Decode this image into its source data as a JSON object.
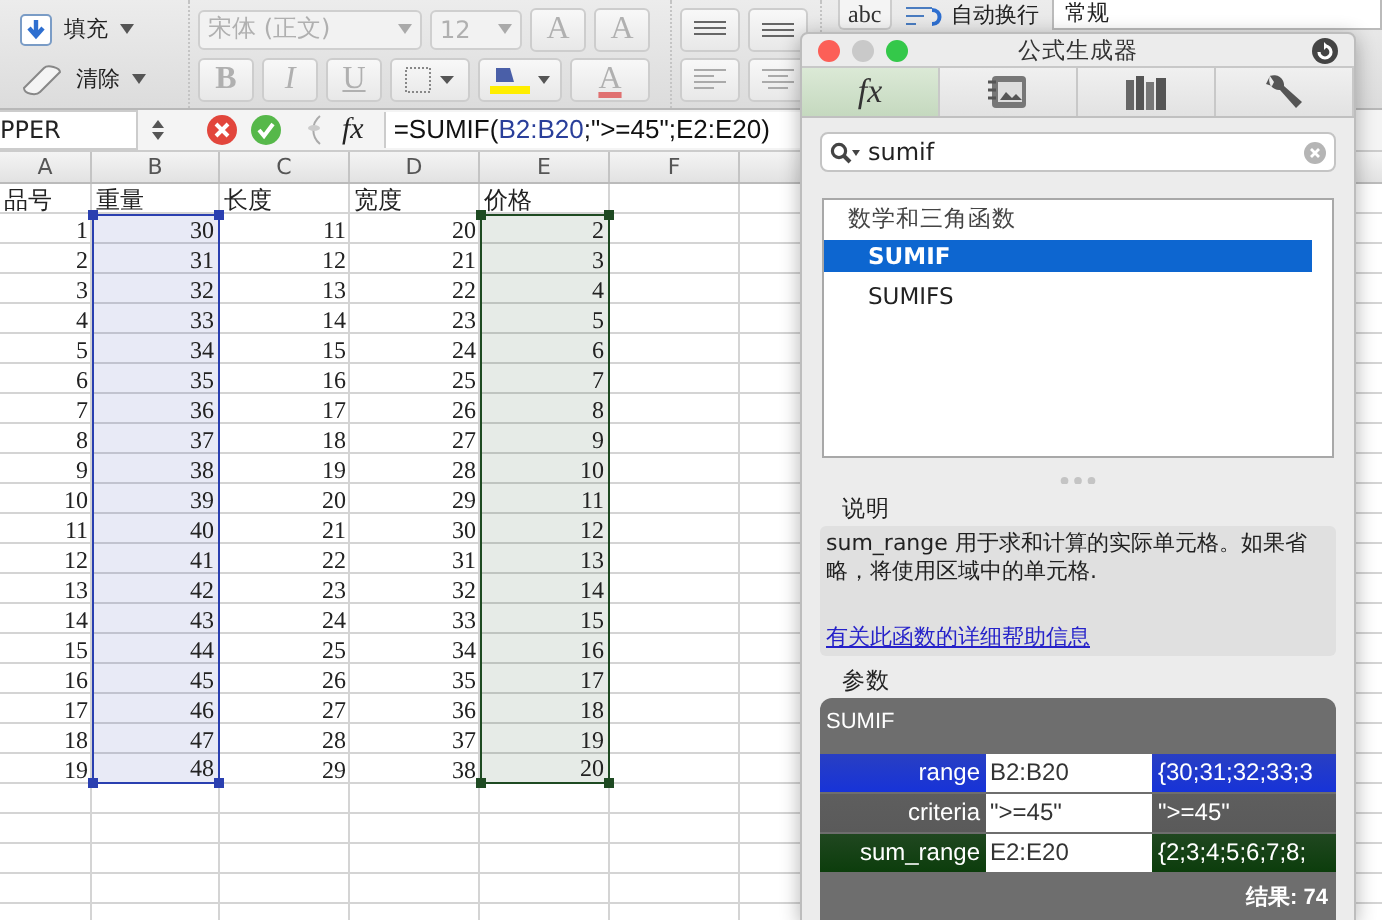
{
  "ribbon": {
    "fill_button": "填充",
    "clear_button": "清除",
    "font_name": "宋体 (正文)",
    "font_size": "12",
    "grow_font": "A",
    "shrink_font": "A",
    "bold": "B",
    "italic": "I",
    "underline": "U",
    "font_color": "A",
    "abc_button": "abc",
    "wrap_button": "自动换行",
    "number_format": "常规"
  },
  "formula_bar": {
    "name_box": "PPER",
    "fx": "fx",
    "formula_parts": [
      {
        "text": "=SUMIF(",
        "color": "#111111"
      },
      {
        "text": "B2:B20",
        "color": "#2a3f9a"
      },
      {
        "text": ";\">=45\";",
        "color": "#111111"
      },
      {
        "text": "E2:E20",
        "color": "#111111"
      },
      {
        "text": ")",
        "color": "#111111"
      }
    ]
  },
  "sheet": {
    "columns": [
      {
        "label": "A"
      },
      {
        "label": "B",
        "color": "#2a3fb0"
      },
      {
        "label": "C"
      },
      {
        "label": "D"
      },
      {
        "label": "E",
        "color": "#1e4a22"
      },
      {
        "label": "F"
      }
    ],
    "header_row": [
      "品号",
      "重量",
      "长度",
      "宽度",
      "价格"
    ],
    "rows": [
      [
        "1",
        "30",
        "11",
        "20",
        "2"
      ],
      [
        "2",
        "31",
        "12",
        "21",
        "3"
      ],
      [
        "3",
        "32",
        "13",
        "22",
        "4"
      ],
      [
        "4",
        "33",
        "14",
        "23",
        "5"
      ],
      [
        "5",
        "34",
        "15",
        "24",
        "6"
      ],
      [
        "6",
        "35",
        "16",
        "25",
        "7"
      ],
      [
        "7",
        "36",
        "17",
        "26",
        "8"
      ],
      [
        "8",
        "37",
        "18",
        "27",
        "9"
      ],
      [
        "9",
        "38",
        "19",
        "28",
        "10"
      ],
      [
        "10",
        "39",
        "20",
        "29",
        "11"
      ],
      [
        "11",
        "40",
        "21",
        "30",
        "12"
      ],
      [
        "12",
        "41",
        "22",
        "31",
        "13"
      ],
      [
        "13",
        "42",
        "23",
        "32",
        "14"
      ],
      [
        "14",
        "43",
        "24",
        "33",
        "15"
      ],
      [
        "15",
        "44",
        "25",
        "34",
        "16"
      ],
      [
        "16",
        "45",
        "26",
        "35",
        "17"
      ],
      [
        "17",
        "46",
        "27",
        "36",
        "18"
      ],
      [
        "18",
        "47",
        "28",
        "37",
        "19"
      ],
      [
        "19",
        "48",
        "29",
        "38",
        "20"
      ]
    ]
  },
  "dialog": {
    "title": "公式生成器",
    "tabs": [
      {
        "kind": "fx",
        "label": "fx",
        "selected": true
      },
      {
        "kind": "media",
        "selected": false
      },
      {
        "kind": "library",
        "selected": false
      },
      {
        "kind": "tools",
        "selected": false
      }
    ],
    "search": {
      "value": "sumif"
    },
    "function_list": {
      "category": "数学和三角函数",
      "items": [
        {
          "name": "SUMIF",
          "selected": true
        },
        {
          "name": "SUMIFS",
          "selected": false
        }
      ]
    },
    "description": {
      "heading": "说明",
      "text": "sum_range 用于求和计算的实际单元格。如果省略，将使用区域中的单元格.",
      "link": "有关此函数的详细帮助信息"
    },
    "arguments": {
      "heading": "参数",
      "function": "SUMIF",
      "rows": [
        {
          "name": "range",
          "value": "B2:B20",
          "result": "{30;31;32;33;3",
          "color": "#1733d8"
        },
        {
          "name": "criteria",
          "value": "\">=45\"",
          "result": "\">=45\"",
          "color": "#5a5a5a"
        },
        {
          "name": "sum_range",
          "value": "E2:E20",
          "result": "{2;3;4;5;6;7;8;",
          "color": "#0c3d0c"
        }
      ],
      "result": "结果: 74"
    }
  }
}
